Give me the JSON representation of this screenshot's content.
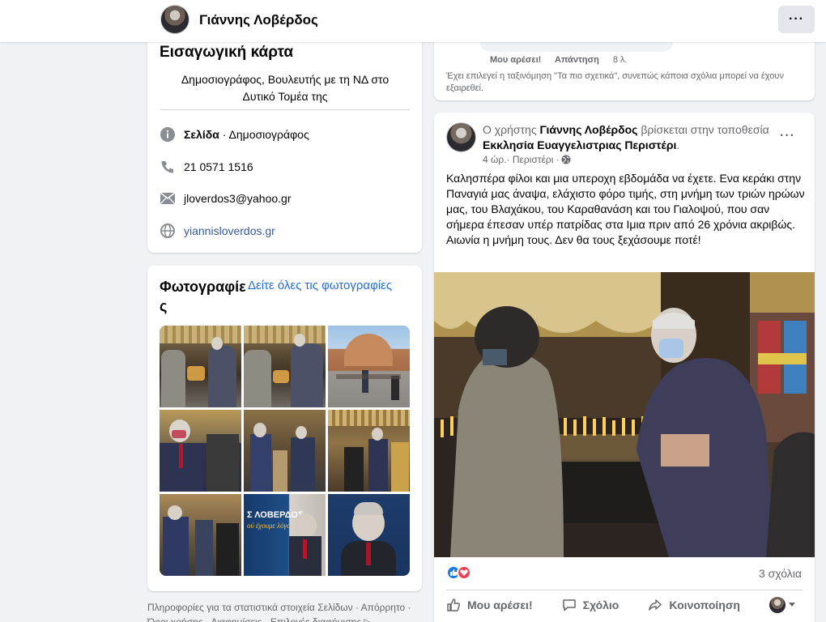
{
  "header": {
    "page_name": "Γιάννης Λοβέρδος",
    "more_label": "···"
  },
  "intro": {
    "title": "Εισαγωγική κάρτα",
    "bio": "Δημοσιογράφος, Βουλευτής με τη ΝΔ στο Δυτικό Τομέα της",
    "category_label": "Σελίδα",
    "category_value": " · Δημοσιογράφος",
    "phone": "21 0571 1516",
    "email": "jloverdos3@yahoo.gr",
    "website": "yiannisloverdos.gr"
  },
  "photos": {
    "title": "Φωτογραφίες",
    "see_all": "Δείτε όλες τις φωτογραφίες"
  },
  "footer": {
    "text": "Πληροφορίες για τα στατιστικά στοιχεία Σελίδων · Απόρρητο · Όροι χρήσης · Διαφημίσεις · Επιλογές διαφήμισης ▷ ·"
  },
  "prev_comment": {
    "like": "Μου αρέσει!",
    "reply": "Απάντηση",
    "time": "8 λ.",
    "note": "Έχει επιλεγεί η ταξινόμηση \"Τα πιο σχετικά\", συνεπώς κάποια σχόλια μπορεί να έχουν εξαιρεθεί."
  },
  "post": {
    "prefix": "Ο χρήστης ",
    "author": "Γιάννης Λοβέρδος",
    "mid": " βρίσκεται στην τοποθεσία ",
    "location": "Εκκλησία Ευαγγελιστριας Περιστέρι",
    "suffix": ".",
    "time": "4 ώρ.",
    "place": " · Περιστέρι · ",
    "text": "Καλησπέρα φίλοι και μια υπεροχη εβδομάδα να έχετε. Ενα κεράκι στην Παναγιά μας άναψα, ελάχιστο φόρο τιμής, στη μνήμη των τριών ηρώων μας, του Βλαχάκου, του Καραθανάση και του Γιαλοψού, που σαν σήμερα έπεσαν υπέρ πατρίδας στα Ιμια πριν από 26 χρόνια ακριβώς. Αιωνία η μνήμη τους. Δεν θα τους ξεχάσουμε ποτέ!",
    "comments_count": "3 σχόλια",
    "like_label": "Μου αρέσει!",
    "comment_label": "Σχόλιο",
    "share_label": "Κοινοποίηση"
  },
  "colors": {
    "link": "#216fdb",
    "like_blue": "#1877f2",
    "love_red": "#f33e58"
  }
}
